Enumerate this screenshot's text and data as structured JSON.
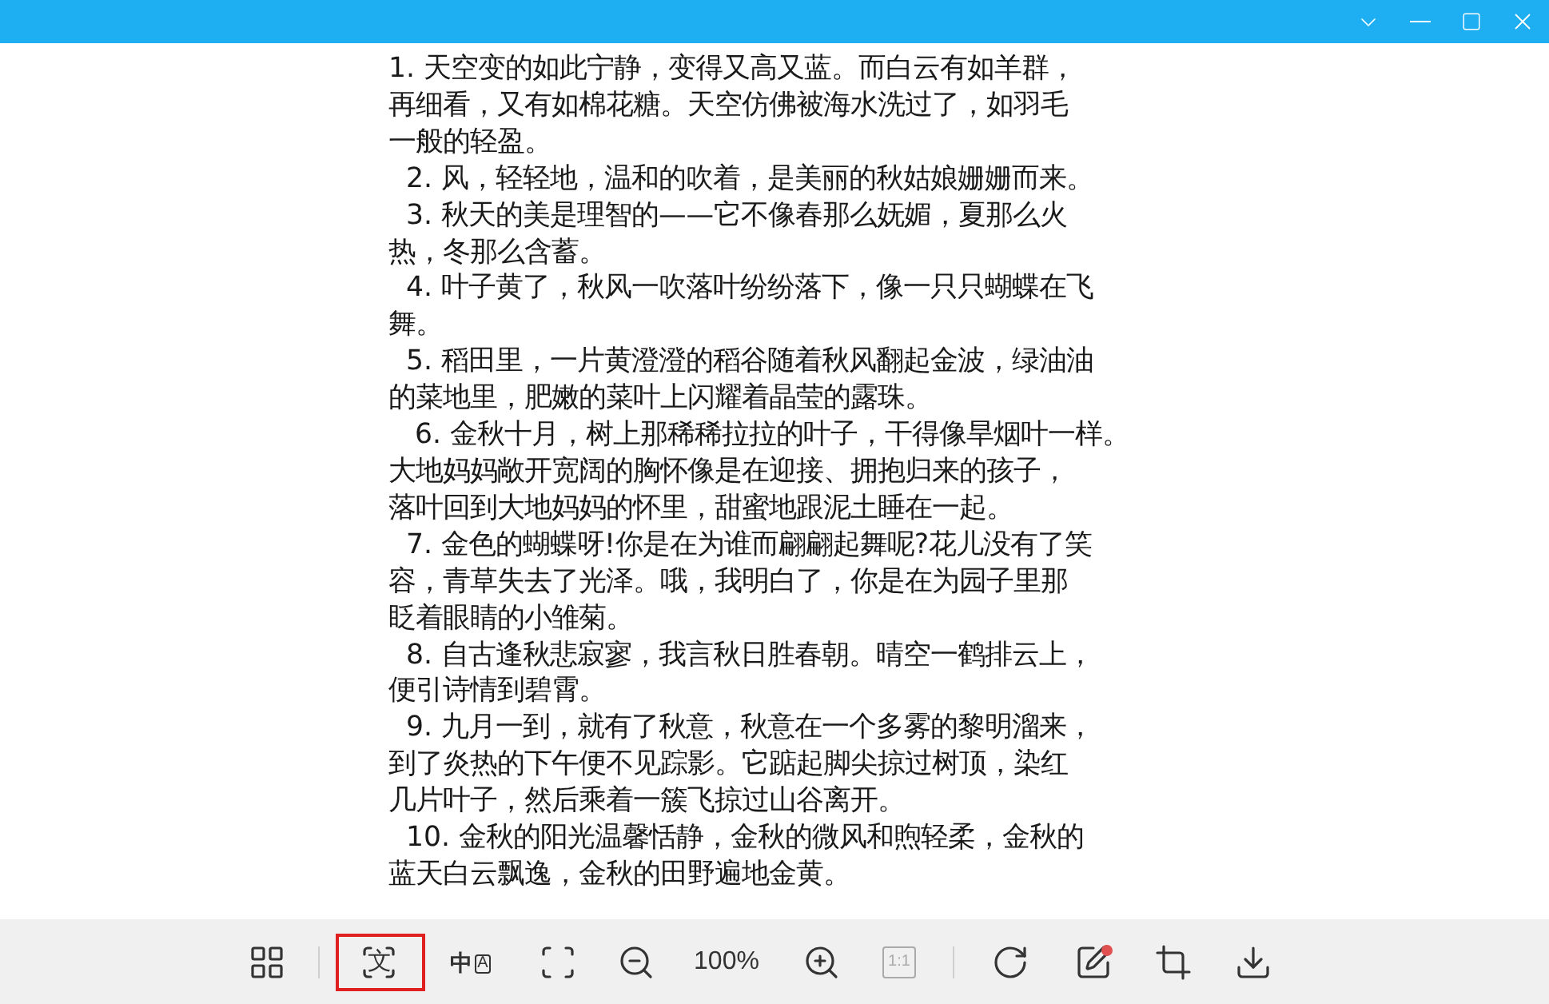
{
  "document": {
    "lines": [
      "1. 天空变的如此宁静，变得又高又蓝。而白云有如羊群，",
      "再细看，又有如棉花糖。天空仿佛被海水洗过了，如羽毛",
      "一般的轻盈。",
      "  2. 风，轻轻地，温和的吹着，是美丽的秋姑娘姗姗而来。",
      "  3. 秋天的美是理智的——它不像春那么妩媚，夏那么火",
      "热，冬那么含蓄。",
      "  4. 叶子黄了，秋风一吹落叶纷纷落下，像一只只蝴蝶在飞",
      "舞。",
      "  5. 稻田里，一片黄澄澄的稻谷随着秋风翻起金波，绿油油",
      "的菜地里，肥嫩的菜叶上闪耀着晶莹的露珠。",
      "   6. 金秋十月，树上那稀稀拉拉的叶子，干得像旱烟叶一样。",
      "大地妈妈敞开宽阔的胸怀像是在迎接、拥抱归来的孩子，",
      "落叶回到大地妈妈的怀里，甜蜜地跟泥土睡在一起。",
      "  7. 金色的蝴蝶呀!你是在为谁而翩翩起舞呢?花儿没有了笑",
      "容，青草失去了光泽。哦，我明白了，你是在为园子里那",
      "眨着眼睛的小雏菊。",
      "  8. 自古逢秋悲寂寥，我言秋日胜春朝。晴空一鹤排云上，",
      "便引诗情到碧霄。",
      "  9. 九月一到，就有了秋意，秋意在一个多雾的黎明溜来，",
      "到了炎热的下午便不见踪影。它踮起脚尖掠过树顶，染红",
      "几片叶子，然后乘着一簇飞掠过山谷离开。",
      "  10. 金秋的阳光温馨恬静，金秋的微风和煦轻柔，金秋的",
      "蓝天白云飘逸，金秋的田野遍地金黄。"
    ]
  },
  "toolbar": [
    {
      "kind": "layout",
      "selected": false
    },
    {
      "kind": "divider"
    },
    {
      "kind": "ocr",
      "glyph": "文",
      "selected": true
    },
    {
      "kind": "translate",
      "glyphs": [
        "中",
        "A"
      ],
      "selected": false
    },
    {
      "kind": "fit",
      "selected": false
    },
    {
      "kind": "zoom-out",
      "selected": false
    },
    {
      "kind": "zoom-level",
      "text": "100%"
    },
    {
      "kind": "zoom-in",
      "selected": false
    },
    {
      "kind": "actual-size",
      "label": "1:1",
      "disabled": true,
      "selected": false
    },
    {
      "kind": "divider"
    },
    {
      "kind": "rotate",
      "selected": false
    },
    {
      "kind": "edit",
      "badge": true,
      "selected": false
    },
    {
      "kind": "crop",
      "selected": false
    },
    {
      "kind": "download",
      "selected": false
    }
  ]
}
